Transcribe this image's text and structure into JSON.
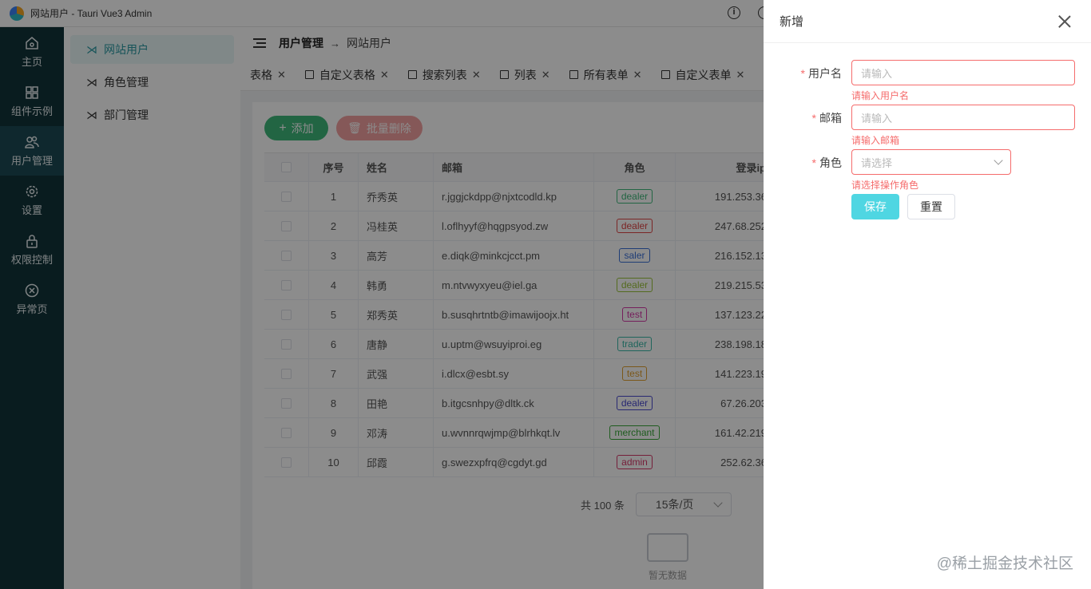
{
  "window": {
    "title": "网站用户 - Tauri Vue3 Admin"
  },
  "nav": [
    {
      "label": "主页",
      "icon": "home-icon"
    },
    {
      "label": "组件示例",
      "icon": "grid-icon"
    },
    {
      "label": "用户管理",
      "icon": "users-icon",
      "active": true
    },
    {
      "label": "设置",
      "icon": "gear-icon"
    },
    {
      "label": "权限控制",
      "icon": "lock-icon"
    },
    {
      "label": "异常页",
      "icon": "error-icon"
    }
  ],
  "submenu": [
    {
      "label": "网站用户",
      "active": true
    },
    {
      "label": "角色管理"
    },
    {
      "label": "部门管理"
    }
  ],
  "breadcrumb": {
    "parent": "用户管理",
    "separator": "→",
    "current": "网站用户"
  },
  "tabs": [
    {
      "label": "表格"
    },
    {
      "label": "自定义表格"
    },
    {
      "label": "搜索列表"
    },
    {
      "label": "列表"
    },
    {
      "label": "所有表单"
    },
    {
      "label": "自定义表单"
    }
  ],
  "toolbar": {
    "add_label": "添加",
    "batch_delete_label": "批量删除"
  },
  "table": {
    "headers": {
      "index": "序号",
      "name": "姓名",
      "email": "邮箱",
      "role": "角色",
      "ip": "登录ip"
    },
    "rows": [
      {
        "index": "1",
        "name": "乔秀英",
        "email": "r.jggjckdpp@njxtcodld.kp",
        "role": "dealer",
        "role_color": "#3eb87a",
        "ip": "191.253.36"
      },
      {
        "index": "2",
        "name": "冯桂英",
        "email": "l.oflhyyf@hqgpsyod.zw",
        "role": "dealer",
        "role_color": "#e04545",
        "ip": "247.68.252"
      },
      {
        "index": "3",
        "name": "高芳",
        "email": "e.diqk@minkcjcct.pm",
        "role": "saler",
        "role_color": "#3a6fd8",
        "ip": "216.152.13"
      },
      {
        "index": "4",
        "name": "韩勇",
        "email": "m.ntvwyxyeu@iel.ga",
        "role": "dealer",
        "role_color": "#9ac43a",
        "ip": "219.215.53"
      },
      {
        "index": "5",
        "name": "郑秀英",
        "email": "b.susqhrtntb@imawijoojx.ht",
        "role": "test",
        "role_color": "#d63aa8",
        "ip": "137.123.22"
      },
      {
        "index": "6",
        "name": "唐静",
        "email": "u.uptm@wsuyiproi.eg",
        "role": "trader",
        "role_color": "#3ab8a8",
        "ip": "238.198.18"
      },
      {
        "index": "7",
        "name": "武强",
        "email": "i.dlcx@esbt.sy",
        "role": "test",
        "role_color": "#e0a030",
        "ip": "141.223.19"
      },
      {
        "index": "8",
        "name": "田艳",
        "email": "b.itgcsnhpy@dltk.ck",
        "role": "dealer",
        "role_color": "#4a4ad0",
        "ip": "67.26.203"
      },
      {
        "index": "9",
        "name": "邓涛",
        "email": "u.wvnnrqwjmp@blrhkqt.lv",
        "role": "merchant",
        "role_color": "#3aa83a",
        "ip": "161.42.219"
      },
      {
        "index": "10",
        "name": "邱霞",
        "email": "g.swezxpfrq@cgdyt.gd",
        "role": "admin",
        "role_color": "#d63a6a",
        "ip": "252.62.36"
      }
    ]
  },
  "pagination": {
    "total": "共 100 条",
    "page_size": "15条/页"
  },
  "empty": {
    "text": "暂无数据"
  },
  "drawer": {
    "title": "新增",
    "fields": {
      "username": {
        "label": "用户名",
        "placeholder": "请输入",
        "error": "请输入用户名"
      },
      "email": {
        "label": "邮箱",
        "placeholder": "请输入",
        "error": "请输入邮箱"
      },
      "role": {
        "label": "角色",
        "placeholder": "请选择",
        "error": "请选择操作角色"
      }
    },
    "save_label": "保存",
    "reset_label": "重置"
  },
  "watermark": "@稀土掘金技术社区"
}
